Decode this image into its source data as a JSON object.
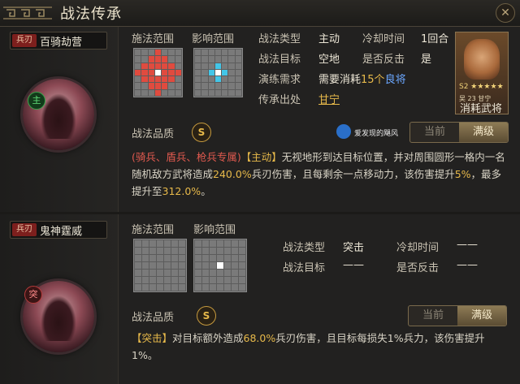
{
  "title": "战法传承",
  "tactic1": {
    "badge": "兵刃",
    "name": "百骑劫营",
    "emblem_mark": "主",
    "label_cast_range": "施法范围",
    "label_effect_range": "影响范围",
    "label_type": "战法类型",
    "value_type": "主动",
    "label_cooldown": "冷却时间",
    "value_cooldown": "1回合",
    "label_target": "战法目标",
    "value_target": "空地",
    "label_counter": "是否反击",
    "value_counter": "是",
    "label_train": "演练需求",
    "train_prefix": "需要消耗",
    "train_count": "15个",
    "train_item": "良将",
    "label_source": "传承出处",
    "value_source": "甘宁",
    "portrait_stars": "S2 ★★★★★",
    "portrait_meta": "吴 23 甘宁",
    "portrait_caption": "消耗武将",
    "label_quality": "战法品质",
    "quality": "S",
    "watermark": "爱发现的飓风",
    "tab_current": "当前",
    "tab_full": "满级",
    "desc_restrict": "(骑兵、盾兵、枪兵专属)",
    "desc_tag": "【主动】",
    "desc_a": "无视地形到达目标位置，并对周围圆形一格内一名随机敌方武将造成",
    "desc_pct1": "240.0%",
    "desc_b": "兵刃伤害，且每剩余一点移动力，该伤害提升",
    "desc_pct2": "5%",
    "desc_c": "，最多提升至",
    "desc_pct3": "312.0%",
    "desc_d": "。"
  },
  "tactic2": {
    "badge": "兵刃",
    "name": "鬼神霆威",
    "emblem_mark": "突",
    "label_cast_range": "施法范围",
    "label_effect_range": "影响范围",
    "label_type": "战法类型",
    "value_type": "突击",
    "label_cooldown": "冷却时间",
    "value_cooldown": "——",
    "label_target": "战法目标",
    "value_target": "——",
    "label_counter": "是否反击",
    "value_counter": "——",
    "label_quality": "战法品质",
    "quality": "S",
    "tab_current": "当前",
    "tab_full": "满级",
    "desc_tag": "【突击】",
    "desc_a": "对目标额外造成",
    "desc_pct1": "68.0%",
    "desc_b": "兵刃伤害，且目标每损失1%兵力，该伤害提升1%。"
  }
}
